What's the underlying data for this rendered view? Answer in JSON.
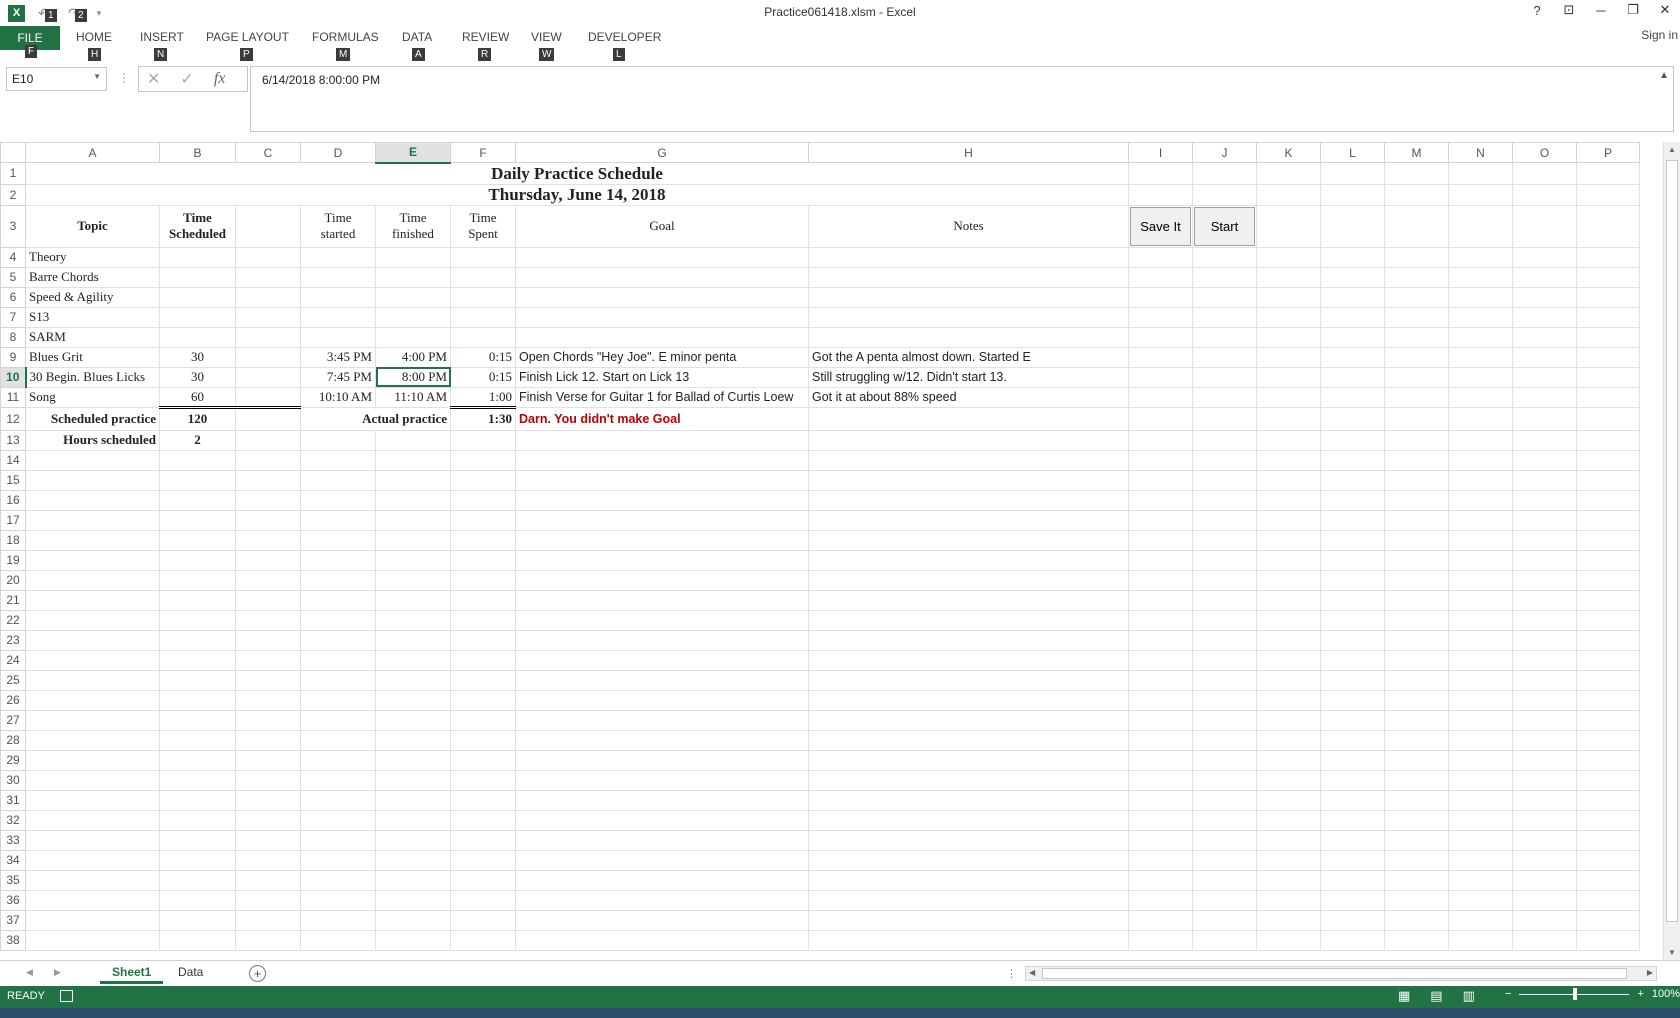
{
  "window": {
    "title": "Practice061418.xlsm - Excel",
    "sign_in": "Sign in",
    "help": "?",
    "minimize": "─",
    "restore": "❐",
    "close": "✕"
  },
  "qat": {
    "undo_keytip": "1",
    "redo_keytip": "2"
  },
  "ribbon": {
    "file": "FILE",
    "file_key": "F",
    "tabs": [
      {
        "label": "HOME",
        "key": "H"
      },
      {
        "label": "INSERT",
        "key": "N"
      },
      {
        "label": "PAGE LAYOUT",
        "key": "P"
      },
      {
        "label": "FORMULAS",
        "key": "M"
      },
      {
        "label": "DATA",
        "key": "A"
      },
      {
        "label": "REVIEW",
        "key": "R"
      },
      {
        "label": "VIEW",
        "key": "W"
      },
      {
        "label": "DEVELOPER",
        "key": "L"
      }
    ]
  },
  "formula_bar": {
    "name_box": "E10",
    "fx": "fx",
    "value": "6/14/2018  8:00:00 PM"
  },
  "columns": [
    "A",
    "B",
    "C",
    "D",
    "E",
    "F",
    "G",
    "H",
    "I",
    "J",
    "K",
    "L",
    "M",
    "N",
    "O",
    "P"
  ],
  "sheet": {
    "title": "Daily Practice Schedule",
    "date": "Thursday, June 14, 2018",
    "headers": {
      "topic": "Topic",
      "time_sched_1": "Time",
      "time_sched_2": "Scheduled",
      "time_started_1": "Time",
      "time_started_2": "started",
      "time_finished_1": "Time",
      "time_finished_2": "finished",
      "time_spent_1": "Time",
      "time_spent_2": "Spent",
      "goal": "Goal",
      "notes": "Notes"
    },
    "buttons": {
      "save": "Save It",
      "start": "Start"
    },
    "topics": [
      {
        "topic": "Theory",
        "sched": "",
        "started": "",
        "finished": "",
        "spent": "",
        "goal": "",
        "notes": ""
      },
      {
        "topic": "Barre Chords",
        "sched": "",
        "started": "",
        "finished": "",
        "spent": "",
        "goal": "",
        "notes": ""
      },
      {
        "topic": "Speed & Agility",
        "sched": "",
        "started": "",
        "finished": "",
        "spent": "",
        "goal": "",
        "notes": ""
      },
      {
        "topic": "S13",
        "sched": "",
        "started": "",
        "finished": "",
        "spent": "",
        "goal": "",
        "notes": ""
      },
      {
        "topic": "SARM",
        "sched": "",
        "started": "",
        "finished": "",
        "spent": "",
        "goal": "",
        "notes": ""
      },
      {
        "topic": "Blues Grit",
        "sched": "30",
        "started": "3:45 PM",
        "finished": "4:00 PM",
        "spent": "0:15",
        "goal": "Open Chords \"Hey Joe\".  E minor penta",
        "notes": "Got the A penta almost down.  Started E"
      },
      {
        "topic": "30 Begin. Blues Licks",
        "sched": "30",
        "started": "7:45 PM",
        "finished": "8:00 PM",
        "spent": "0:15",
        "goal": "Finish Lick 12.  Start on Lick 13",
        "notes": "Still struggling w/12.  Didn't start 13."
      },
      {
        "topic": "Song",
        "sched": "60",
        "started": "10:10 AM",
        "finished": "11:10 AM",
        "spent": "1:00",
        "goal": "Finish Verse for Guitar 1 for Ballad of Curtis Loew",
        "notes": "Got it at about 88% speed"
      }
    ],
    "scheduled_label": "Scheduled practice",
    "scheduled_total": "120",
    "actual_label": "Actual practice",
    "actual_total": "1:30",
    "message": "Darn.  You didn't make Goal",
    "hours_label": "Hours scheduled",
    "hours_value": "2"
  },
  "rows": [
    "1",
    "2",
    "3",
    "4",
    "5",
    "6",
    "7",
    "8",
    "9",
    "10",
    "11",
    "12",
    "13",
    "14",
    "15",
    "16",
    "17",
    "18",
    "19",
    "20",
    "21",
    "22",
    "23",
    "24",
    "25",
    "26",
    "27",
    "28",
    "29",
    "30",
    "31",
    "32",
    "33",
    "34",
    "35",
    "36",
    "37",
    "38"
  ],
  "tabs": {
    "sheet1": "Sheet1",
    "data": "Data",
    "add": "+"
  },
  "status": {
    "ready": "READY",
    "zoom": "100%",
    "minus": "−",
    "plus": "+"
  },
  "colors": {
    "accent": "#217346",
    "alert": "#c00000"
  }
}
